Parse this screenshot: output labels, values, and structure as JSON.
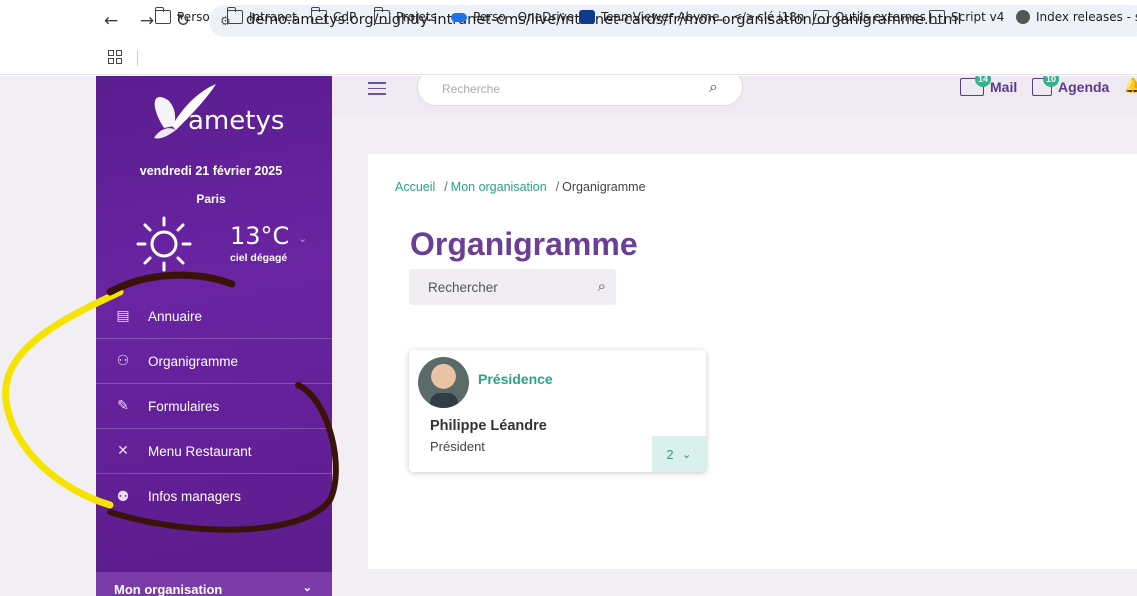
{
  "browser": {
    "url": "demo.ametys.org/nightly-intranet-cms/live/intranet-cards/fr/mon-organisation/organigramme.html",
    "bookmarks": [
      "Perso",
      "Intranet",
      "CdP",
      "Projets",
      "Perso - OneDrive",
      "TeamViewer Abyme...",
      "clé i18n",
      "Outils externes",
      "Script  v4",
      "Index releases - sol"
    ]
  },
  "sidebar": {
    "logo_text": "ametys",
    "date": "vendredi 21 février 2025",
    "city": "Paris",
    "temperature": "13°C",
    "sky": "ciel dégagé",
    "menu": [
      {
        "label": "Annuaire",
        "icon": "id-card-icon"
      },
      {
        "label": "Organigramme",
        "icon": "org-chart-icon"
      },
      {
        "label": "Formulaires",
        "icon": "form-icon"
      },
      {
        "label": "Menu Restaurant",
        "icon": "utensils-icon"
      },
      {
        "label": "Infos managers",
        "icon": "managers-icon"
      }
    ],
    "section_label": "Mon organisation"
  },
  "topbar": {
    "search_placeholder": "Recherche",
    "mail_label": "Mail",
    "mail_badge": "14",
    "agenda_label": "Agenda",
    "agenda_badge": "10"
  },
  "main": {
    "breadcrumb": [
      "Accueil",
      "Mon organisation",
      "Organigramme"
    ],
    "title": "Organigramme",
    "search_placeholder": "Rechercher",
    "card": {
      "unit": "Présidence",
      "name": "Philippe Léandre",
      "role": "Président",
      "children_count": "2"
    }
  },
  "colors": {
    "sidebar": "#5e1f94",
    "accent_green": "#2aa389",
    "title_purple": "#6b3f93",
    "annotation_yellow": "#f5e400",
    "annotation_brown": "#3a1208"
  }
}
